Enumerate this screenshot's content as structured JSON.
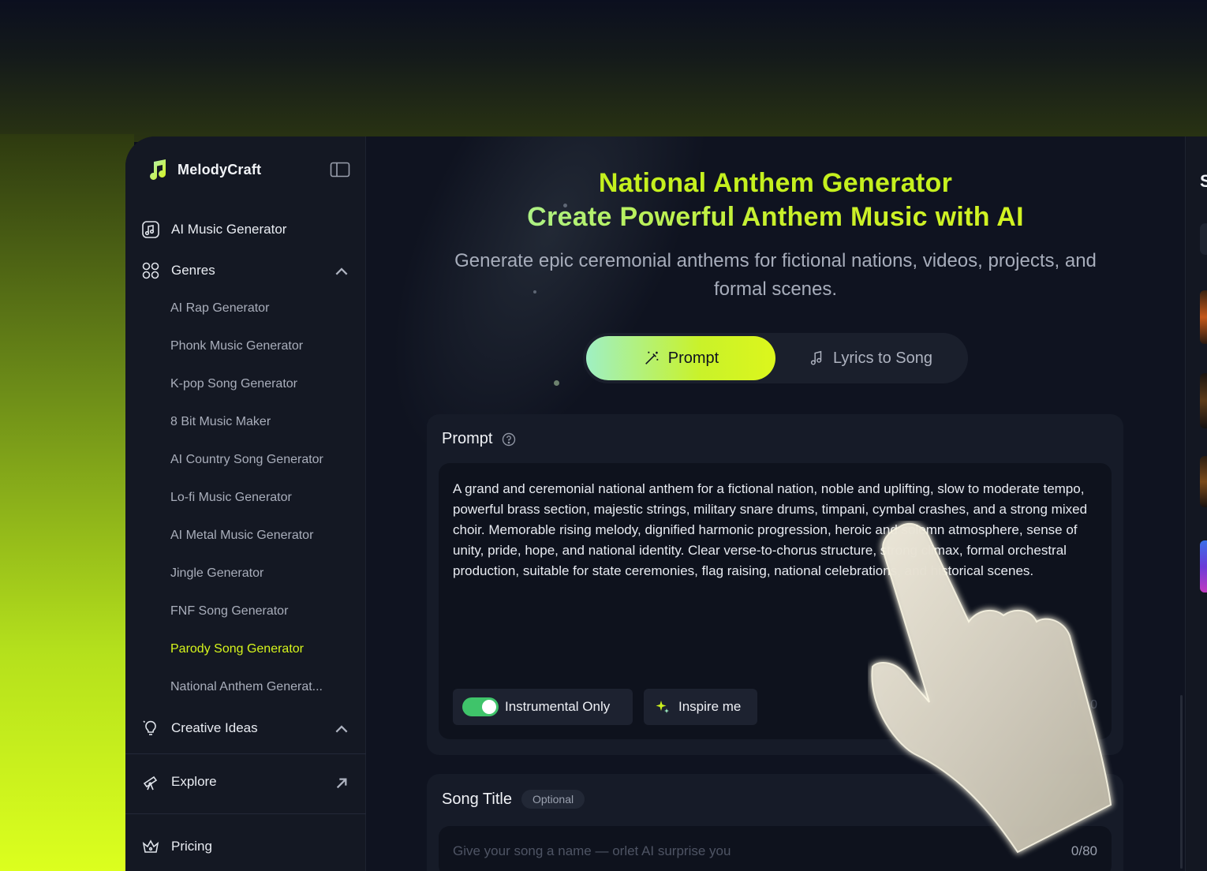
{
  "brand": {
    "name": "MelodyCraft"
  },
  "sidebar": {
    "ai_music": "AI Music Generator",
    "genres": "Genres",
    "genre_items": [
      "AI Rap Generator",
      "Phonk Music Generator",
      "K-pop Song Generator",
      "8 Bit Music Maker",
      "AI Country Song Generator",
      "Lo-fi Music Generator",
      "AI Metal Music Generator",
      "Jingle Generator",
      "FNF Song Generator",
      "Parody Song Generator",
      "National Anthem Generat..."
    ],
    "active_item": "Parody Song Generator",
    "creative_ideas": "Creative Ideas",
    "explore": "Explore",
    "pricing": "Pricing"
  },
  "hero": {
    "title": "National Anthem Generator",
    "subtitle_bold": "Create Powerful Anthem Music with AI",
    "description": "Generate epic ceremonial anthems for fictional nations, videos, projects, and formal scenes."
  },
  "tabs": {
    "prompt": "Prompt",
    "lyrics": "Lyrics to Song"
  },
  "prompt_card": {
    "label": "Prompt",
    "text": "A grand and ceremonial national anthem for a fictional nation, noble and uplifting, slow to moderate tempo, powerful brass section, majestic strings, military snare drums, timpani, cymbal crashes, and a strong mixed choir. Memorable rising melody, dignified harmonic progression, heroic and solemn atmosphere, sense of unity, pride, hope, and national identity. Clear verse-to-chorus structure, strong climax, formal orchestral production, suitable for state ceremonies, flag raising, national celebrations, and historical scenes.",
    "instrumental_label": "Instrumental Only",
    "instrumental_on": true,
    "inspire_label": "Inspire me",
    "counter": "0/...0"
  },
  "title_card": {
    "label": "Song Title",
    "badge": "Optional",
    "placeholder": "Give your song a name — orlet AI surprise you",
    "counter": "0/80"
  },
  "right_panel": {
    "letter": "S"
  },
  "colors": {
    "accent": "#d6f51c",
    "toggle": "#3fc46a",
    "background": "#0f1320"
  }
}
